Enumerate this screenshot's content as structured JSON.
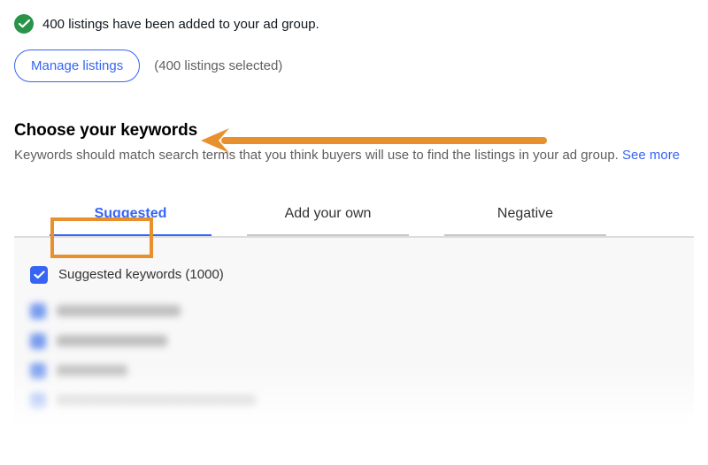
{
  "success": {
    "message": "400 listings have been added to your ad group."
  },
  "manage": {
    "button_label": "Manage listings",
    "selected_text": "(400 listings selected)"
  },
  "section": {
    "title": "Choose your keywords",
    "description": "Keywords should match search terms that you think buyers will use to find the listings in your ad group. ",
    "see_more": "See more"
  },
  "tabs": {
    "suggested": "Suggested",
    "add_own": "Add your own",
    "negative": "Negative",
    "active": "suggested"
  },
  "keywords": {
    "header_label": "Suggested keywords (1000)",
    "header_checked": true
  }
}
